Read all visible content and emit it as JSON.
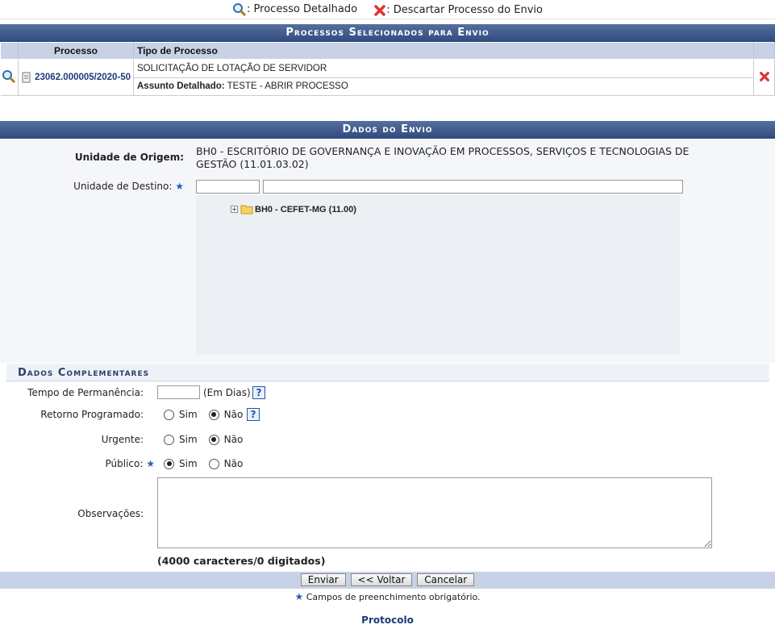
{
  "legend": {
    "detail_label": ": Processo Detalhado",
    "discard_label": ": Descartar Processo do Envio"
  },
  "selected": {
    "title": "Processos Selecionados para Envio",
    "col_processo": "Processo",
    "col_tipo": "Tipo de Processo",
    "row": {
      "number": "23062.000005/2020-50",
      "tipo": "SOLICITAÇÃO DE LOTAÇÃO DE SERVIDOR",
      "assunto_label": "Assunto Detalhado:",
      "assunto_value": " TESTE - ABRIR PROCESSO"
    }
  },
  "envio": {
    "title": "Dados do Envio",
    "origem_label": "Unidade de Origem:",
    "origem_value": "BH0 - ESCRITÓRIO DE GOVERNANÇA E INOVAÇÃO EM PROCESSOS, SERVIÇOS E TECNOLOGIAS DE GESTÃO (11.01.03.02)",
    "destino_label": "Unidade de Destino:",
    "destino_code": "",
    "destino_name": "",
    "tree_node": "BH0 - CEFET-MG (11.00)"
  },
  "complementares": {
    "title": "Dados Complementares",
    "tempo_label": "Tempo de Permanência:",
    "tempo_value": "",
    "tempo_unit": "(Em Dias)",
    "retorno_label": "Retorno Programado:",
    "urgente_label": "Urgente:",
    "publico_label": "Público:",
    "opt_sim": "Sim",
    "opt_nao": "Não",
    "retorno_selected": "Não",
    "urgente_selected": "Não",
    "publico_selected": "Sim",
    "obs_label": "Observações:",
    "obs_value": "",
    "counter": "(4000 caracteres/0 digitados)"
  },
  "buttons": {
    "enviar": "Enviar",
    "voltar": "<< Voltar",
    "cancelar": "Cancelar"
  },
  "required_note": "Campos de preenchimento obrigatório.",
  "footer_link": "Protocolo",
  "help_glyph": "?",
  "required_glyph": "★",
  "colors": {
    "header_bar": "#3b5485",
    "sub_header": "#c8d2e6",
    "link": "#1f3a7a"
  }
}
